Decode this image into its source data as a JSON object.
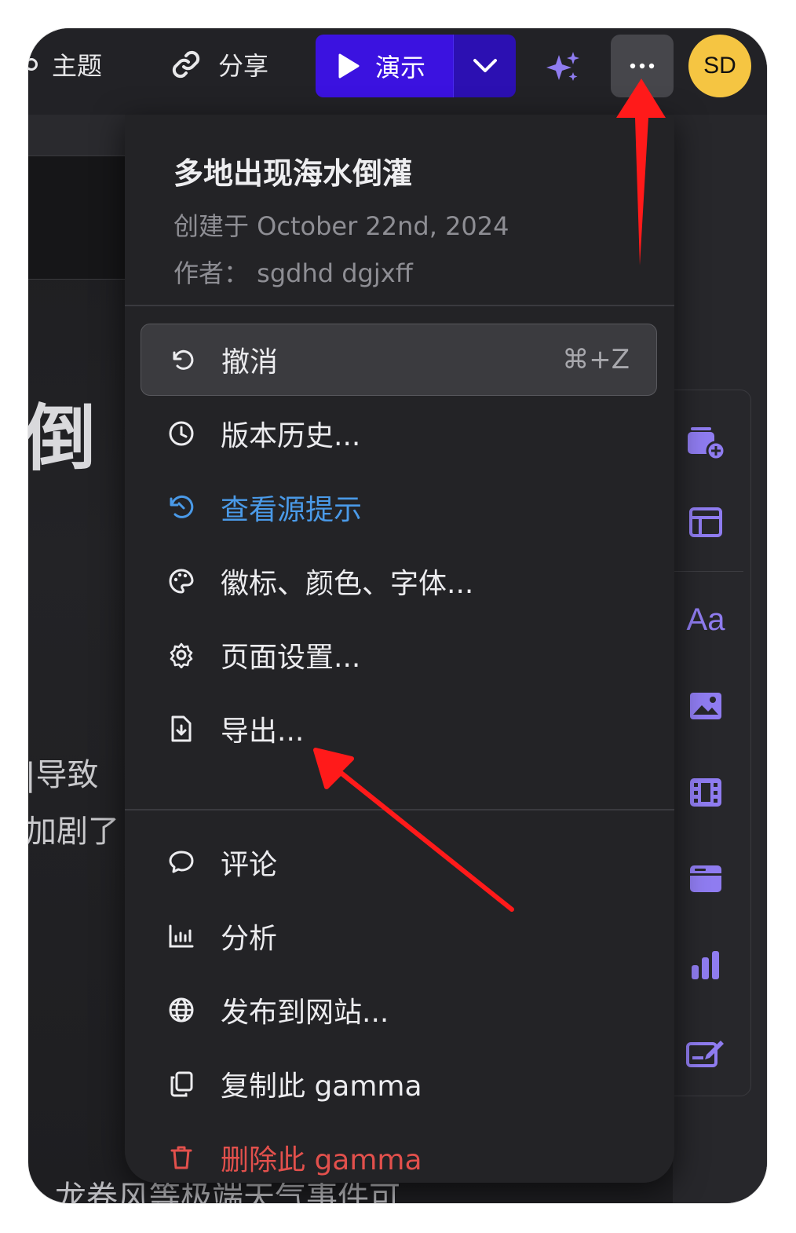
{
  "toolbar": {
    "theme_label": "主题",
    "share_label": "分享",
    "present_label": "演示",
    "avatar_initials": "SD"
  },
  "background": {
    "heading_fragment": "倒",
    "text_line_1": "|导致",
    "text_line_2": "加剧了",
    "bottom_line": "、龙卷风等极端天气事件可"
  },
  "menu": {
    "doc_title": "多地出现海水倒灌",
    "created": "创建于 October 22nd, 2024",
    "author": "作者：  sgdhd dgjxff",
    "items": [
      {
        "label": "撤消",
        "shortcut": "⌘+Z",
        "icon": "undo-icon"
      },
      {
        "label": "版本历史...",
        "icon": "clock-icon"
      },
      {
        "label": "查看源提示",
        "icon": "history-prompt-icon"
      },
      {
        "label": "徽标、颜色、字体...",
        "icon": "palette-icon"
      },
      {
        "label": "页面设置...",
        "icon": "gear-icon"
      },
      {
        "label": "导出...",
        "icon": "export-file-icon"
      },
      {
        "label": "评论",
        "icon": "comment-icon"
      },
      {
        "label": "分析",
        "icon": "analytics-icon"
      },
      {
        "label": "发布到网站...",
        "icon": "globe-icon"
      },
      {
        "label": "复制此 gamma",
        "icon": "duplicate-icon"
      },
      {
        "label": "删除此 gamma",
        "icon": "trash-icon"
      }
    ]
  },
  "colors": {
    "present_button": "#3b12e0",
    "accent_purple": "#8f7cf0",
    "link_blue": "#4a9ae8",
    "danger_red": "#e2504c",
    "avatar_yellow": "#f5c542",
    "annotation_red": "#ff1a1a"
  }
}
